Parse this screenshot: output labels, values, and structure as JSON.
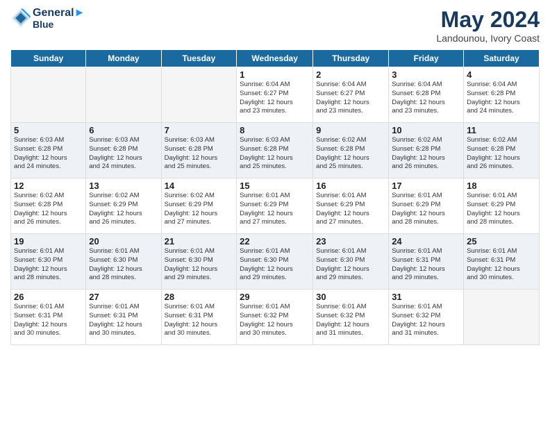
{
  "header": {
    "logo_line1": "General",
    "logo_line2": "Blue",
    "month": "May 2024",
    "location": "Landounou, Ivory Coast"
  },
  "days_of_week": [
    "Sunday",
    "Monday",
    "Tuesday",
    "Wednesday",
    "Thursday",
    "Friday",
    "Saturday"
  ],
  "weeks": [
    [
      {
        "num": "",
        "empty": true
      },
      {
        "num": "",
        "empty": true
      },
      {
        "num": "",
        "empty": true
      },
      {
        "num": "1",
        "info": "Sunrise: 6:04 AM\nSunset: 6:27 PM\nDaylight: 12 hours\nand 23 minutes."
      },
      {
        "num": "2",
        "info": "Sunrise: 6:04 AM\nSunset: 6:27 PM\nDaylight: 12 hours\nand 23 minutes."
      },
      {
        "num": "3",
        "info": "Sunrise: 6:04 AM\nSunset: 6:28 PM\nDaylight: 12 hours\nand 23 minutes."
      },
      {
        "num": "4",
        "info": "Sunrise: 6:04 AM\nSunset: 6:28 PM\nDaylight: 12 hours\nand 24 minutes."
      }
    ],
    [
      {
        "num": "5",
        "info": "Sunrise: 6:03 AM\nSunset: 6:28 PM\nDaylight: 12 hours\nand 24 minutes."
      },
      {
        "num": "6",
        "info": "Sunrise: 6:03 AM\nSunset: 6:28 PM\nDaylight: 12 hours\nand 24 minutes."
      },
      {
        "num": "7",
        "info": "Sunrise: 6:03 AM\nSunset: 6:28 PM\nDaylight: 12 hours\nand 25 minutes."
      },
      {
        "num": "8",
        "info": "Sunrise: 6:03 AM\nSunset: 6:28 PM\nDaylight: 12 hours\nand 25 minutes."
      },
      {
        "num": "9",
        "info": "Sunrise: 6:02 AM\nSunset: 6:28 PM\nDaylight: 12 hours\nand 25 minutes."
      },
      {
        "num": "10",
        "info": "Sunrise: 6:02 AM\nSunset: 6:28 PM\nDaylight: 12 hours\nand 26 minutes."
      },
      {
        "num": "11",
        "info": "Sunrise: 6:02 AM\nSunset: 6:28 PM\nDaylight: 12 hours\nand 26 minutes."
      }
    ],
    [
      {
        "num": "12",
        "info": "Sunrise: 6:02 AM\nSunset: 6:28 PM\nDaylight: 12 hours\nand 26 minutes."
      },
      {
        "num": "13",
        "info": "Sunrise: 6:02 AM\nSunset: 6:29 PM\nDaylight: 12 hours\nand 26 minutes."
      },
      {
        "num": "14",
        "info": "Sunrise: 6:02 AM\nSunset: 6:29 PM\nDaylight: 12 hours\nand 27 minutes."
      },
      {
        "num": "15",
        "info": "Sunrise: 6:01 AM\nSunset: 6:29 PM\nDaylight: 12 hours\nand 27 minutes."
      },
      {
        "num": "16",
        "info": "Sunrise: 6:01 AM\nSunset: 6:29 PM\nDaylight: 12 hours\nand 27 minutes."
      },
      {
        "num": "17",
        "info": "Sunrise: 6:01 AM\nSunset: 6:29 PM\nDaylight: 12 hours\nand 28 minutes."
      },
      {
        "num": "18",
        "info": "Sunrise: 6:01 AM\nSunset: 6:29 PM\nDaylight: 12 hours\nand 28 minutes."
      }
    ],
    [
      {
        "num": "19",
        "info": "Sunrise: 6:01 AM\nSunset: 6:30 PM\nDaylight: 12 hours\nand 28 minutes."
      },
      {
        "num": "20",
        "info": "Sunrise: 6:01 AM\nSunset: 6:30 PM\nDaylight: 12 hours\nand 28 minutes."
      },
      {
        "num": "21",
        "info": "Sunrise: 6:01 AM\nSunset: 6:30 PM\nDaylight: 12 hours\nand 29 minutes."
      },
      {
        "num": "22",
        "info": "Sunrise: 6:01 AM\nSunset: 6:30 PM\nDaylight: 12 hours\nand 29 minutes."
      },
      {
        "num": "23",
        "info": "Sunrise: 6:01 AM\nSunset: 6:30 PM\nDaylight: 12 hours\nand 29 minutes."
      },
      {
        "num": "24",
        "info": "Sunrise: 6:01 AM\nSunset: 6:31 PM\nDaylight: 12 hours\nand 29 minutes."
      },
      {
        "num": "25",
        "info": "Sunrise: 6:01 AM\nSunset: 6:31 PM\nDaylight: 12 hours\nand 30 minutes."
      }
    ],
    [
      {
        "num": "26",
        "info": "Sunrise: 6:01 AM\nSunset: 6:31 PM\nDaylight: 12 hours\nand 30 minutes."
      },
      {
        "num": "27",
        "info": "Sunrise: 6:01 AM\nSunset: 6:31 PM\nDaylight: 12 hours\nand 30 minutes."
      },
      {
        "num": "28",
        "info": "Sunrise: 6:01 AM\nSunset: 6:31 PM\nDaylight: 12 hours\nand 30 minutes."
      },
      {
        "num": "29",
        "info": "Sunrise: 6:01 AM\nSunset: 6:32 PM\nDaylight: 12 hours\nand 30 minutes."
      },
      {
        "num": "30",
        "info": "Sunrise: 6:01 AM\nSunset: 6:32 PM\nDaylight: 12 hours\nand 31 minutes."
      },
      {
        "num": "31",
        "info": "Sunrise: 6:01 AM\nSunset: 6:32 PM\nDaylight: 12 hours\nand 31 minutes."
      },
      {
        "num": "",
        "empty": true
      }
    ]
  ]
}
